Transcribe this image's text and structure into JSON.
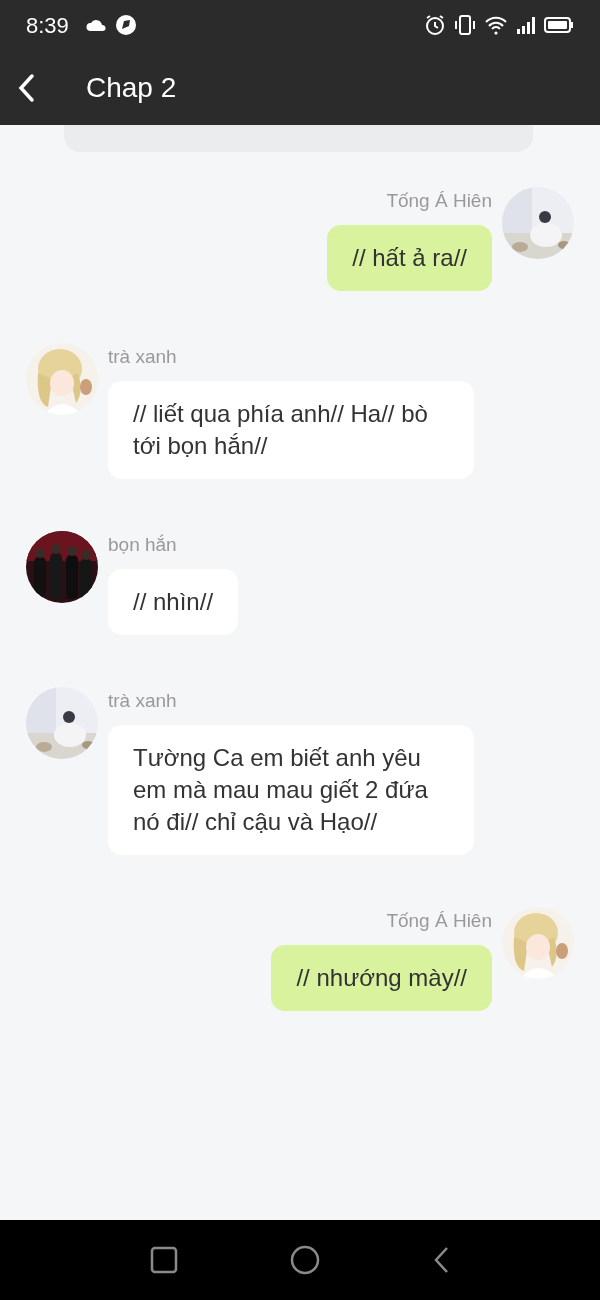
{
  "status_bar": {
    "time": "8:39"
  },
  "header": {
    "title": "Chap 2"
  },
  "messages": [
    {
      "kind": "sent",
      "sender": "Tống Á Hiên",
      "text": "// hất ả ra//"
    },
    {
      "kind": "received",
      "sender": "trà xanh",
      "text": "// liết qua phía anh// Ha// bò tới bọn hắn//"
    },
    {
      "kind": "received",
      "sender": "bọn hắn",
      "text": "// nhìn//"
    },
    {
      "kind": "received",
      "sender": "trà xanh",
      "text": "Tường Ca em biết anh yêu em mà mau mau giết 2 đứa nó đi// chỉ cậu và Hạo//"
    },
    {
      "kind": "sent",
      "sender": "Tống Á Hiên",
      "text": "// nhướng mày//"
    }
  ]
}
